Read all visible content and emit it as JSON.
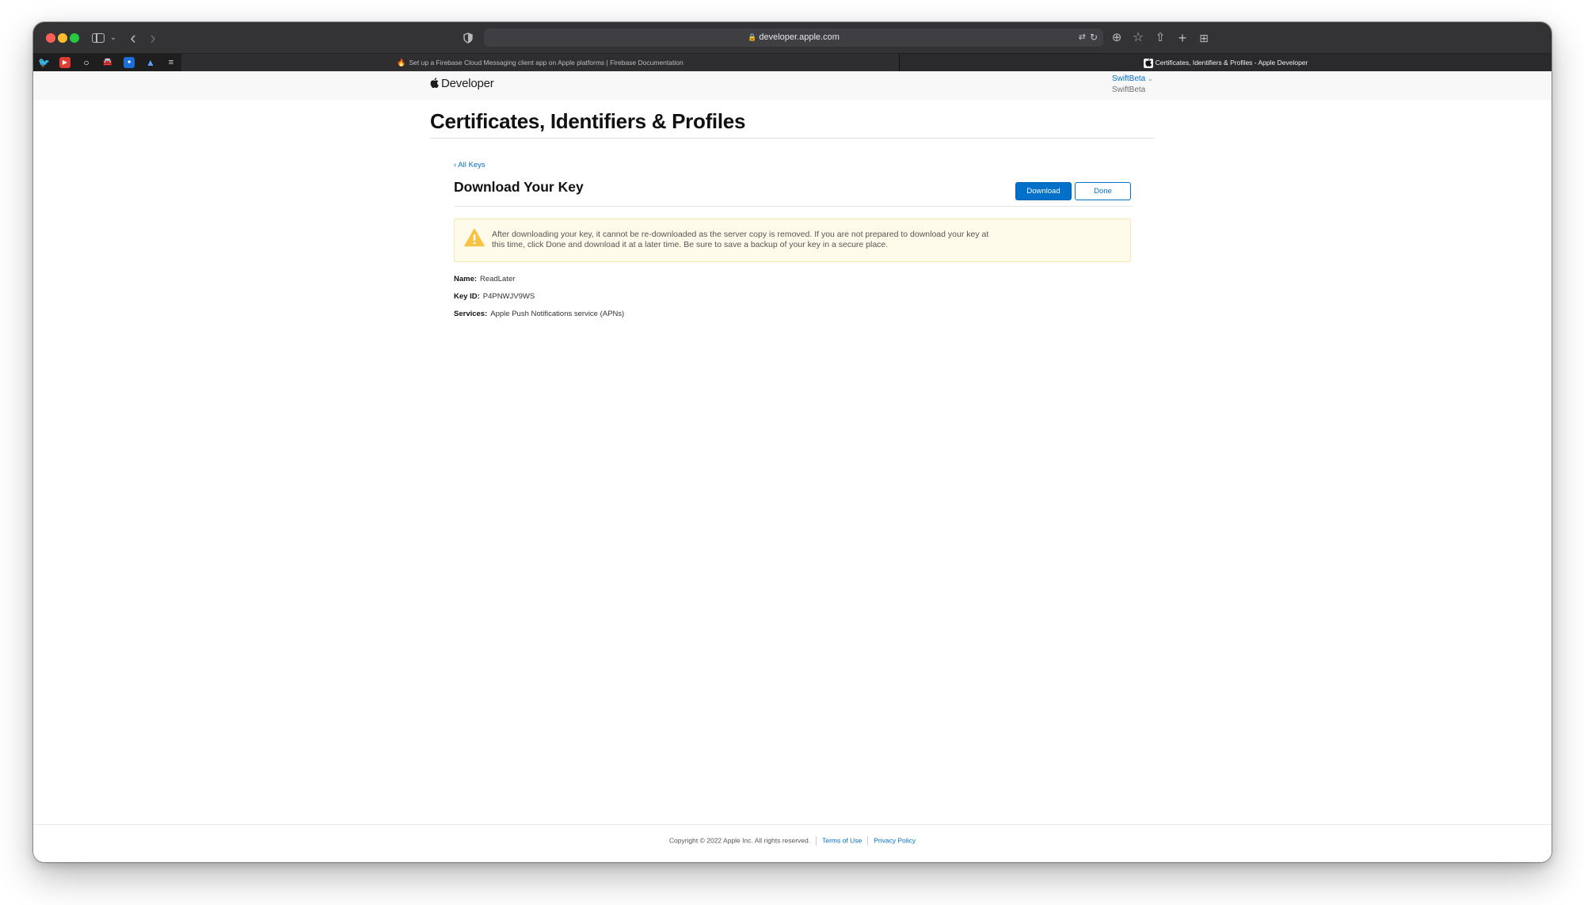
{
  "browser": {
    "url": "developer.apple.com",
    "tabs": [
      {
        "title": "Set up a Firebase Cloud Messaging client app on Apple platforms  |  Firebase Documentation",
        "active": false
      },
      {
        "title": "Certificates, Identifiers & Profiles - Apple Developer",
        "active": true
      }
    ],
    "favorites": [
      "twitter-icon",
      "youtube-icon",
      "circle-icon",
      "car-icon",
      "blue-app-icon",
      "triangle-app-icon",
      "stack-icon"
    ]
  },
  "nav": {
    "logo_text": "Developer",
    "account_name": "SwiftBeta",
    "account_team": "SwiftBeta"
  },
  "main": {
    "title": "Certificates, Identifiers & Profiles",
    "back_link": "All Keys",
    "section_title": "Download Your Key",
    "download_label": "Download",
    "done_label": "Done",
    "warning": "After downloading your key, it cannot be re-downloaded as the server copy is removed. If you are not prepared to download your key at this time, click Done and download it at a later time. Be sure to save a backup of your key in a secure place.",
    "details": [
      {
        "label": "Name:",
        "value": "ReadLater"
      },
      {
        "label": "Key ID:",
        "value": "P4PNWJV9WS"
      },
      {
        "label": "Services:",
        "value": "Apple Push Notifications service (APNs)"
      }
    ]
  },
  "footer": {
    "copyright": "Copyright © 2022 Apple Inc. All rights reserved.",
    "terms": "Terms of Use",
    "privacy": "Privacy Policy"
  },
  "colors": {
    "accent": "#0070c9",
    "warning_bg": "#fffbea",
    "warning_icon": "#f6c343"
  }
}
